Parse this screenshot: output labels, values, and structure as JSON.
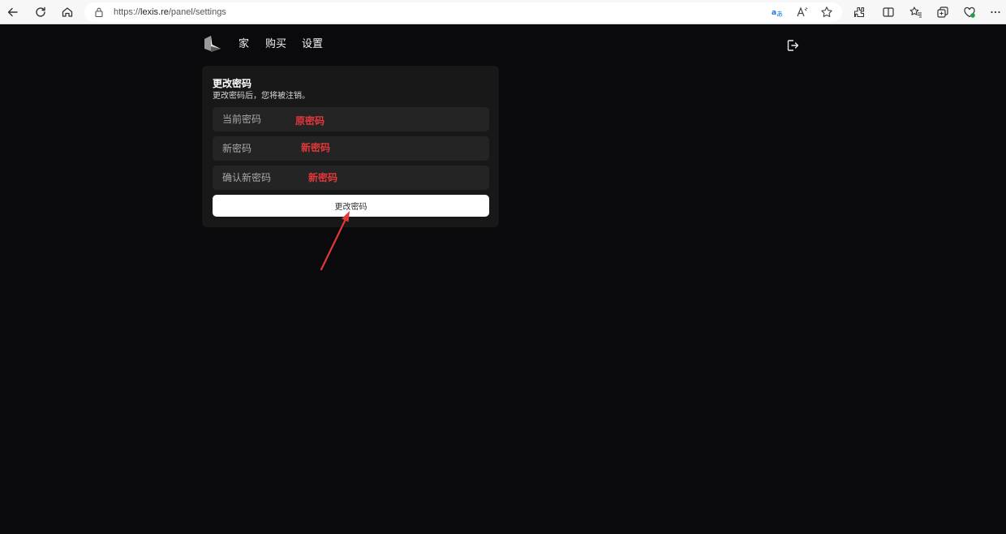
{
  "browser": {
    "url_scheme": "https://",
    "url_host": "lexis.re",
    "url_path": "/panel/settings"
  },
  "nav": {
    "items": [
      {
        "label": "家"
      },
      {
        "label": "购买"
      },
      {
        "label": "设置"
      }
    ]
  },
  "card": {
    "title": "更改密码",
    "subtitle": "更改密码后，您将被注销。",
    "fields": [
      {
        "placeholder": "当前密码",
        "annotation": "原密码"
      },
      {
        "placeholder": "新密码",
        "annotation": "新密码"
      },
      {
        "placeholder": "确认新密码",
        "annotation": "新密码"
      }
    ],
    "submit_label": "更改密码"
  },
  "colors": {
    "page_bg": "#0a0a0c",
    "card_bg": "#181818",
    "field_bg": "#242424",
    "annotation": "#e0383b"
  }
}
